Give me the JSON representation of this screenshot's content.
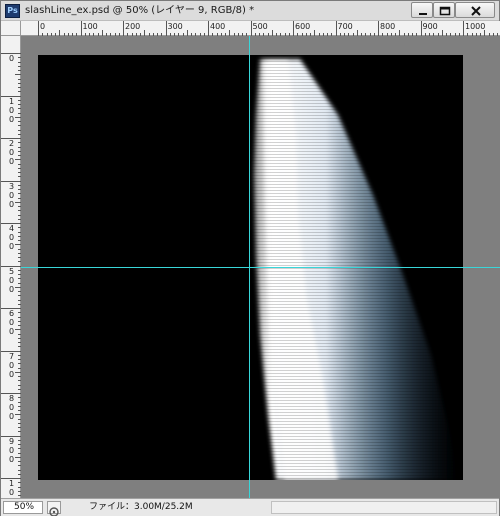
{
  "window": {
    "app_badge": "Ps",
    "title": "slashLine_ex.psd @ 50% (レイヤー 9, RGB/8) *",
    "buttons": {
      "minimize": "minimize",
      "maximize": "maximize",
      "close": "close"
    }
  },
  "ruler": {
    "unit_labels_top": [
      "0",
      "100",
      "200",
      "300",
      "400",
      "500",
      "600",
      "700",
      "800",
      "900",
      "1000"
    ],
    "unit_labels_left": [
      "0",
      "100",
      "200",
      "300",
      "400",
      "500",
      "600",
      "700",
      "800",
      "900",
      "1000"
    ]
  },
  "document": {
    "background": "#000000",
    "guide_color": "#39d6d9",
    "stroke_color": "#ffffff",
    "stroke_tint": "#7fa9c9"
  },
  "status": {
    "zoom": "50%",
    "file_info": "ファイル：3.00M/25.2M"
  },
  "icons": [
    "photoshop-icon",
    "minimize-icon",
    "maximize-icon",
    "close-icon",
    "status-menu-icon"
  ]
}
